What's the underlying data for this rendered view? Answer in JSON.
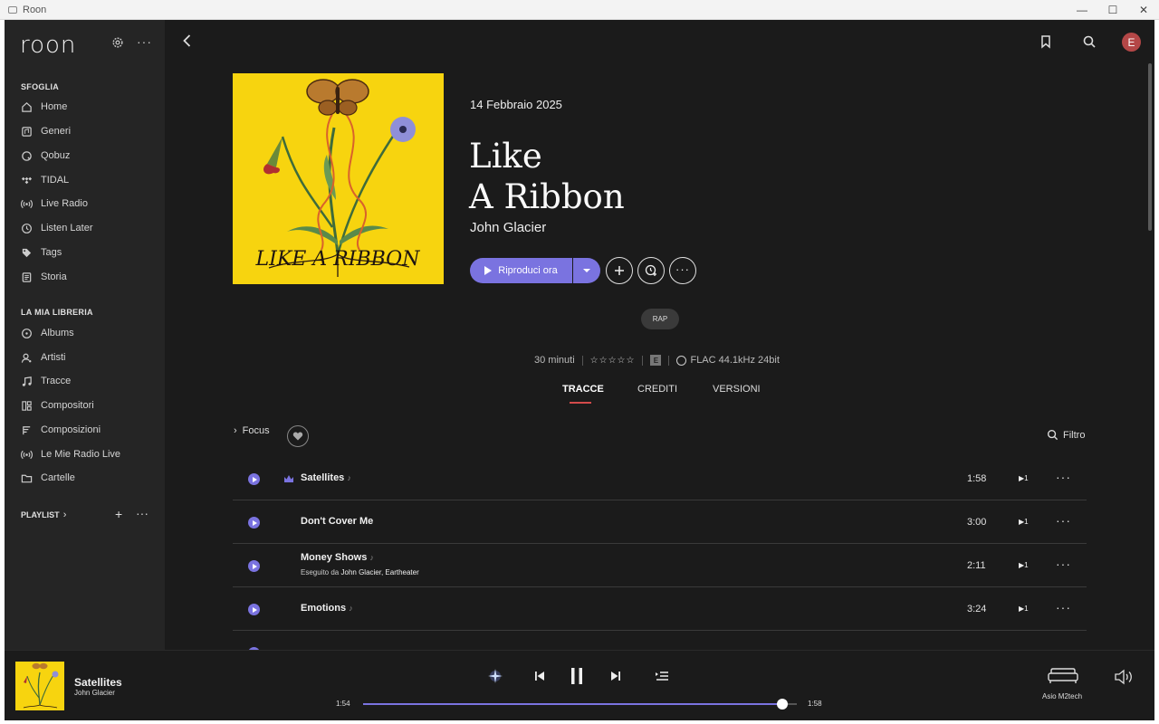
{
  "window": {
    "title": "Roon",
    "minimize": "—",
    "maximize": "☐",
    "close": "✕"
  },
  "sidebar": {
    "logo": "roon",
    "browse_label": "SFOGLIA",
    "browse_items": [
      {
        "label": "Home",
        "icon": "home-icon"
      },
      {
        "label": "Generi",
        "icon": "genres-icon"
      },
      {
        "label": "Qobuz",
        "icon": "qobuz-icon"
      },
      {
        "label": "TIDAL",
        "icon": "tidal-icon"
      },
      {
        "label": "Live Radio",
        "icon": "radio-icon"
      },
      {
        "label": "Listen Later",
        "icon": "clock-icon"
      },
      {
        "label": "Tags",
        "icon": "tag-icon"
      },
      {
        "label": "Storia",
        "icon": "history-icon"
      }
    ],
    "library_label": "LA MIA LIBRERIA",
    "library_items": [
      {
        "label": "Albums",
        "icon": "album-icon"
      },
      {
        "label": "Artisti",
        "icon": "artist-icon"
      },
      {
        "label": "Tracce",
        "icon": "note-icon"
      },
      {
        "label": "Compositori",
        "icon": "composer-icon"
      },
      {
        "label": "Composizioni",
        "icon": "composition-icon"
      },
      {
        "label": "Le Mie Radio Live",
        "icon": "radio-icon"
      },
      {
        "label": "Cartelle",
        "icon": "folder-icon"
      }
    ],
    "playlist_label": "PLAYLIST",
    "playlist_chevron": "›",
    "playlist_add": "+",
    "playlist_more": "···"
  },
  "topbar": {
    "avatar_initial": "E"
  },
  "album": {
    "release_date": "14 Febbraio 2025",
    "title_line1": "Like",
    "title_line2": "A Ribbon",
    "artist": "John Glacier",
    "play_label": "Riproduci ora",
    "genre": "RAP",
    "duration": "30 minuti",
    "rating": "☆☆☆☆☆",
    "explicit": "E",
    "format": "FLAC 44.1kHz 24bit",
    "cover_text": "LIKE A RIBBON"
  },
  "tabs": [
    "TRACCE",
    "CREDITI",
    "VERSIONI"
  ],
  "list_controls": {
    "focus": "Focus",
    "filter": "Filtro"
  },
  "tracks": [
    {
      "name": "Satellites",
      "duration": "1:58",
      "queue": "▶1",
      "sub": "",
      "artists": ""
    },
    {
      "name": "Don't Cover Me",
      "duration": "3:00",
      "queue": "▶1",
      "sub": "",
      "artists": ""
    },
    {
      "name": "Money Shows",
      "duration": "2:11",
      "queue": "▶1",
      "sub": "Eseguito da",
      "artists": "John Glacier, Eartheater"
    },
    {
      "name": "Emotions",
      "duration": "3:24",
      "queue": "▶1",
      "sub": "",
      "artists": ""
    }
  ],
  "player": {
    "title": "Satellites",
    "artist": "John Glacier",
    "elapsed": "1:54",
    "total": "1:58",
    "progress": 0.966,
    "zone": "Asio M2tech"
  },
  "colors": {
    "accent": "#7a73e0",
    "tab_underline": "#d34b4b",
    "cover_bg": "#f7d40f",
    "avatar": "#b44747"
  }
}
